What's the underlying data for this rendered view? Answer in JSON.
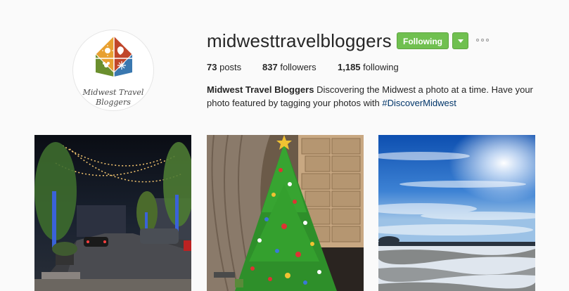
{
  "profile": {
    "username": "midwesttravelbloggers",
    "avatar_text_line1": "Midwest Travel",
    "avatar_text_line2": "Bloggers",
    "follow_label": "Following",
    "dropdown_icon": "caret-down-icon",
    "more_icon": "more-options-icon",
    "accent_color": "#70c050"
  },
  "stats": {
    "posts_count": "73",
    "posts_label": "posts",
    "followers_count": "837",
    "followers_label": "followers",
    "following_count": "1,185",
    "following_label": "following"
  },
  "bio": {
    "name": "Midwest Travel Bloggers",
    "text": "Discovering the Midwest a photo at a time. Have your photo featured by tagging your photos with",
    "hashtag": "#DiscoverMidwest"
  },
  "posts": [
    {
      "subject": "night-street-lights-photo"
    },
    {
      "subject": "lego-christmas-tree-photo"
    },
    {
      "subject": "winter-sky-field-photo"
    }
  ]
}
